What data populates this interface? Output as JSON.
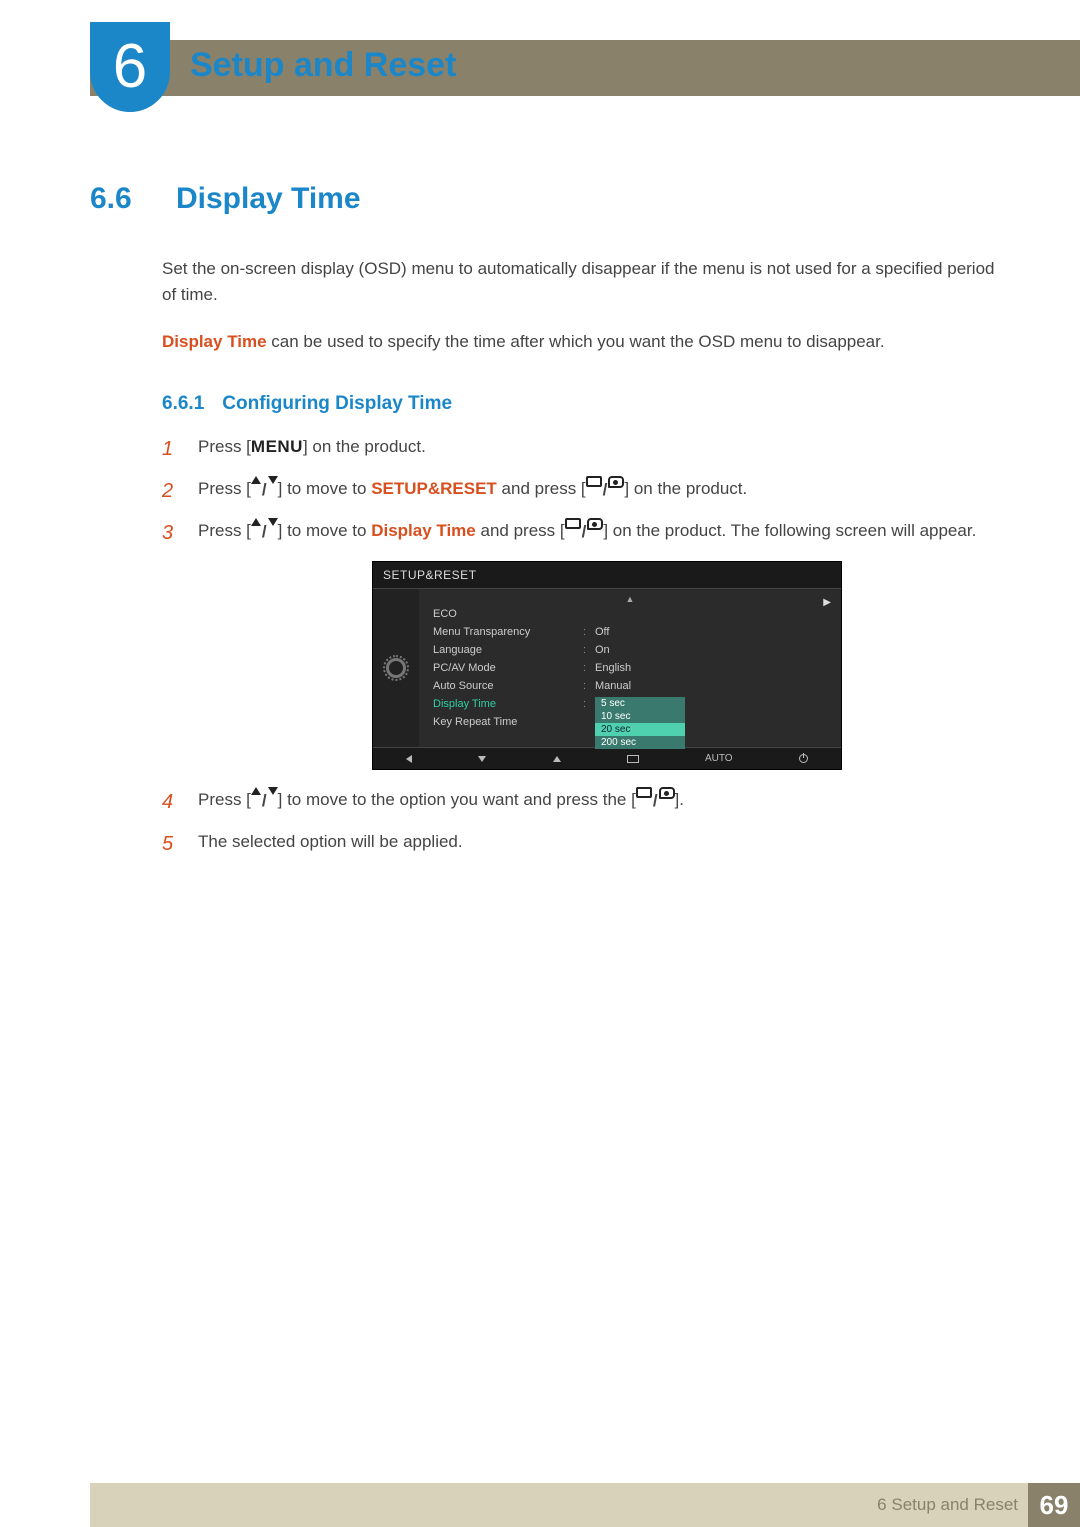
{
  "chapter": {
    "number": "6",
    "title": "Setup and Reset"
  },
  "section": {
    "number": "6.6",
    "title": "Display Time"
  },
  "intro": {
    "p1": "Set the on-screen display (OSD) menu to automatically disappear if the menu is not used for a specified period of time.",
    "p2_highlight": "Display Time",
    "p2_rest": " can be used to specify the time after which you want the OSD menu to disappear."
  },
  "subsection": {
    "number": "6.6.1",
    "title": "Configuring Display Time"
  },
  "steps": {
    "s1": {
      "num": "1",
      "a": "Press [",
      "menu": "MENU",
      "b": "] on the product."
    },
    "s2": {
      "num": "2",
      "a": "Press [",
      "b": "] to move to ",
      "target": "SETUP&RESET",
      "c": " and press [",
      "d": "] on the product."
    },
    "s3": {
      "num": "3",
      "a": "Press [",
      "b": "] to move to ",
      "target": "Display Time",
      "c": " and press [",
      "d": "] on the product. The following screen will appear."
    },
    "s4": {
      "num": "4",
      "a": "Press [",
      "b": "] to move to the option you want and press the [",
      "c": "]."
    },
    "s5": {
      "num": "5",
      "text": "The selected option will be applied."
    }
  },
  "osd": {
    "title": "SETUP&RESET",
    "rows": [
      {
        "label": "ECO",
        "value": ""
      },
      {
        "label": "Menu Transparency",
        "value": "Off"
      },
      {
        "label": "Language",
        "value": "On"
      },
      {
        "label": "PC/AV Mode",
        "value": "English"
      },
      {
        "label": "Auto Source",
        "value": "Manual"
      },
      {
        "label": "Display Time",
        "value": ""
      },
      {
        "label": "Key Repeat Time",
        "value": ""
      }
    ],
    "dropdown": [
      "5 sec",
      "10 sec",
      "20 sec",
      "200 sec"
    ],
    "footer_auto": "AUTO"
  },
  "footer": {
    "text": "6 Setup and Reset",
    "page": "69"
  }
}
